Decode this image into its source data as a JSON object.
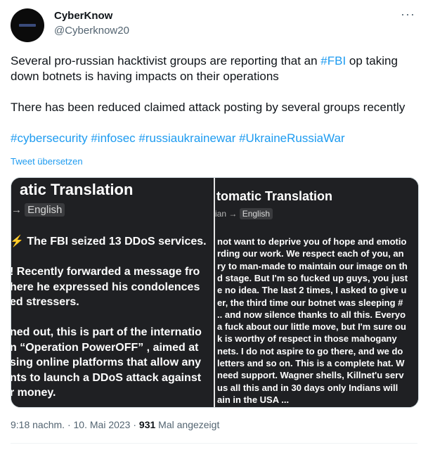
{
  "author": {
    "name": "CyberKnow",
    "handle": "@Cyberknow20",
    "avatar_icon": "cyberknow-logo-avatar"
  },
  "more_icon": "ellipsis-icon",
  "tweet": {
    "para1_a": "Several pro-russian hacktivist groups are reporting that an ",
    "para1_hashtag": "#FBI",
    "para1_b": " op taking down botnets is having impacts on their operations",
    "para2": "There has been reduced claimed attack posting by several groups recently",
    "hashtags": [
      "#cybersecurity",
      "#infosec",
      "#russiaukrainewar",
      "#UkraineRussiaWar"
    ],
    "translate_label": "Tweet übersetzen"
  },
  "media": {
    "left": {
      "title": "atic Translation",
      "lang_prefix": "→",
      "lang": "English",
      "lines": [
        "⚡ The FBI seized 13 DDoS services.",
        "",
        "! Recently forwarded a message fro",
        "here he expressed his condolences",
        "ed stressers.",
        "",
        "ned out, this is part of the internatio",
        "n “Operation PowerOFF” , aimed at",
        "sing online platforms that allow any",
        "nts to launch a DDoS attack against",
        "r money."
      ]
    },
    "right": {
      "title": "tomatic Translation",
      "lang_prefix": "ian →",
      "lang": "English",
      "lines": [
        "not want to deprive you of hope and emotio",
        "rding our work. We respect each of you, an",
        "ry to man-made to maintain our image on th",
        "d stage. But I'm so fucked up guys, you just",
        "e no idea. The last 2 times, I asked to give u",
        "er, the third time our botnet was sleeping #",
        ".. and now silence thanks to all this. Everyo",
        " a fuck about our little move, but I'm sure ou",
        "k is worthy of respect in those mahogany",
        "nets. I do not aspire to go there, and we do",
        " letters and so on. This is a complete hat. W",
        "need support. Wagner shells, Killnet'u serv",
        " us all this and in 30 days only Indians will",
        "ain in the USA ..."
      ]
    }
  },
  "meta": {
    "time": "9:18 nachm.",
    "sep": "·",
    "date": "10. Mai 2023",
    "sep2": "·",
    "views": "931",
    "views_label": "Mal angezeigt"
  }
}
